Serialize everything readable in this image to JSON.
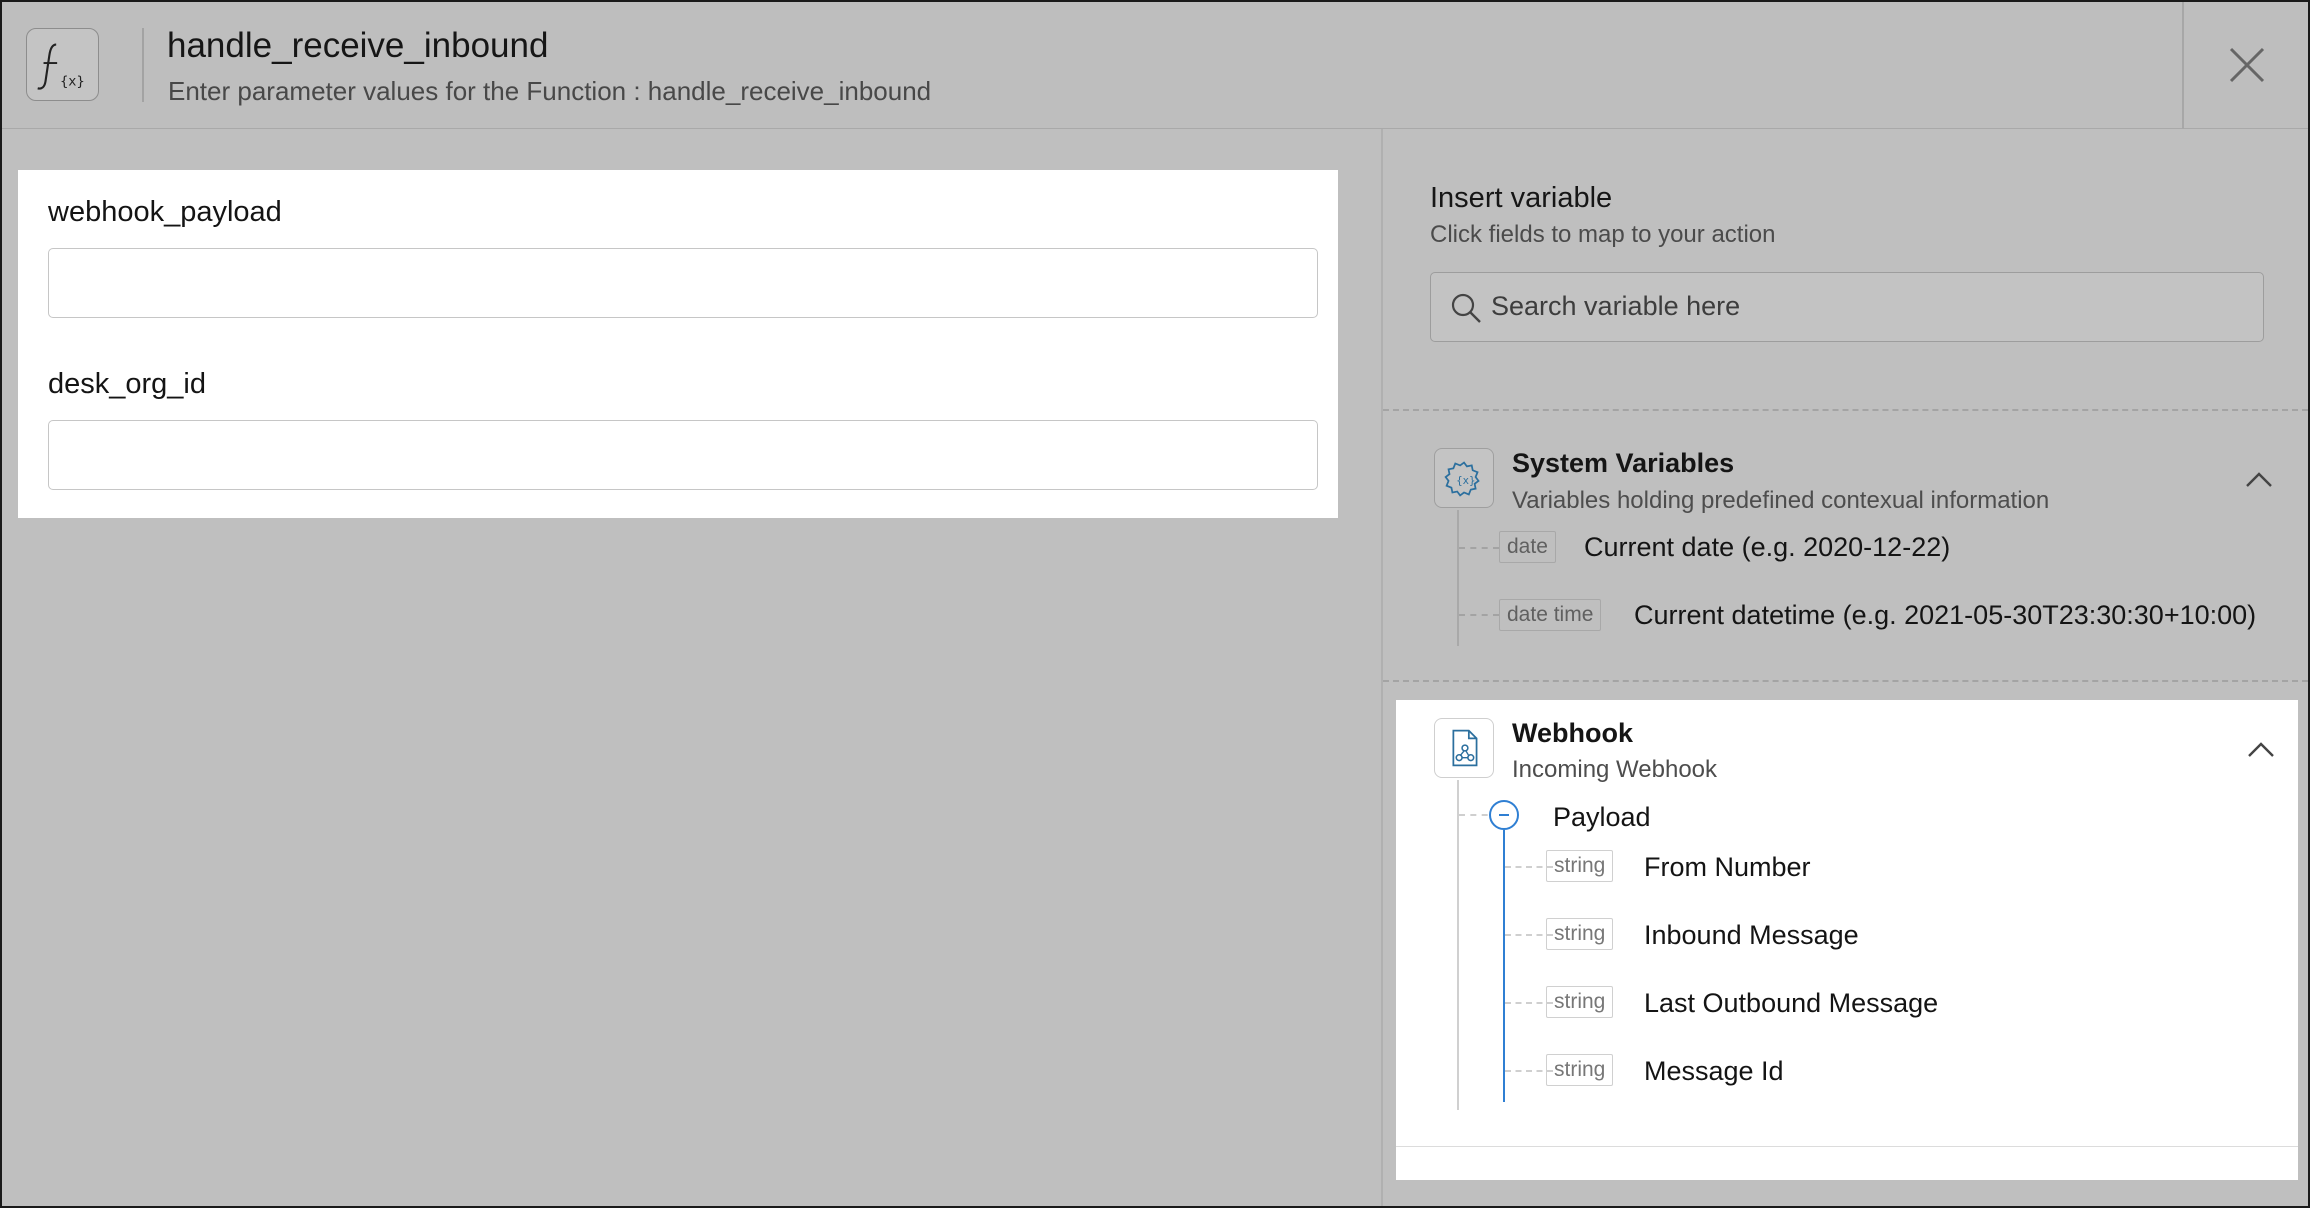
{
  "header": {
    "title": "handle_receive_inbound",
    "subtitle": "Enter parameter values for the Function : handle_receive_inbound"
  },
  "form": {
    "fields": [
      {
        "label": "webhook_payload",
        "value": ""
      },
      {
        "label": "desk_org_id",
        "value": ""
      }
    ]
  },
  "insert_variable": {
    "title": "Insert variable",
    "subtitle": "Click fields to map to your action",
    "search_placeholder": "Search variable here"
  },
  "system_variables": {
    "title": "System Variables",
    "subtitle": "Variables holding predefined contexual information",
    "items": [
      {
        "type": "date",
        "label": "Current date (e.g. 2020-12-22)"
      },
      {
        "type": "date time",
        "label": "Current datetime (e.g. 2021-05-30T23:30:30+10:00)"
      }
    ]
  },
  "webhook": {
    "title": "Webhook",
    "subtitle": "Incoming Webhook",
    "payload_label": "Payload",
    "items": [
      {
        "type": "string",
        "label": "From Number"
      },
      {
        "type": "string",
        "label": "Inbound Message"
      },
      {
        "type": "string",
        "label": "Last Outbound Message"
      },
      {
        "type": "string",
        "label": "Message Id"
      }
    ]
  },
  "colors": {
    "accent": "#2f7fd3",
    "overlay": "#bdbdbd"
  },
  "icons": [
    "function-icon",
    "close-icon",
    "search-icon",
    "gear-variable-icon",
    "webhook-file-icon",
    "chevron-up-icon",
    "collapse-minus-icon"
  ]
}
